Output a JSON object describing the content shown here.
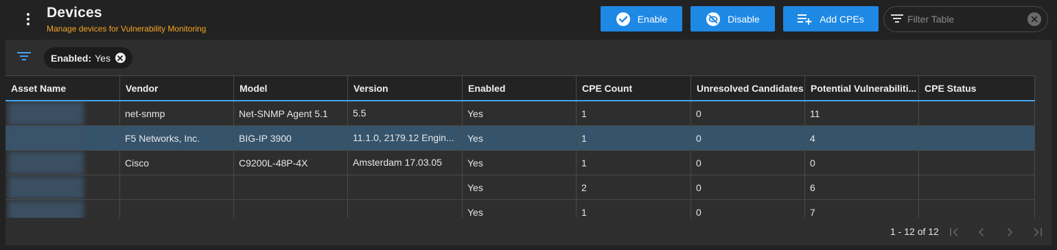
{
  "header": {
    "title": "Devices",
    "subtitle": "Manage devices for Vulnerability Monitoring",
    "menu_icon": "more-vert-icon"
  },
  "toolbar": {
    "enable_label": "Enable",
    "disable_label": "Disable",
    "add_cpes_label": "Add CPEs",
    "filter_placeholder": "Filter Table",
    "filter_value": ""
  },
  "chip": {
    "key": "Enabled:",
    "value": "Yes"
  },
  "table": {
    "columns": [
      "Asset Name",
      "Vendor",
      "Model",
      "Version",
      "Enabled",
      "CPE Count",
      "Unresolved Candidates",
      "Potential Vulnerabiliti...",
      "CPE Status"
    ],
    "rows": [
      {
        "asset": "",
        "vendor": "net-snmp",
        "model": "Net-SNMP Agent 5.1",
        "version": "5.5",
        "enabled": "Yes",
        "cpe_count": "1",
        "unresolved": "0",
        "potential": "11",
        "status": ""
      },
      {
        "asset": "",
        "vendor": "F5 Networks, Inc.",
        "model": "BIG-IP 3900",
        "version": "11.1.0, 2179.12 Engin...",
        "enabled": "Yes",
        "cpe_count": "1",
        "unresolved": "0",
        "potential": "4",
        "status": "",
        "selected": true
      },
      {
        "asset": "",
        "vendor": "Cisco",
        "model": "C9200L-48P-4X",
        "version": "Amsterdam 17.03.05",
        "enabled": "Yes",
        "cpe_count": "1",
        "unresolved": "0",
        "potential": "0",
        "status": ""
      },
      {
        "asset": "",
        "vendor": "",
        "model": "",
        "version": "",
        "enabled": "Yes",
        "cpe_count": "2",
        "unresolved": "0",
        "potential": "6",
        "status": ""
      },
      {
        "asset": "",
        "vendor": "",
        "model": "",
        "version": "",
        "enabled": "Yes",
        "cpe_count": "1",
        "unresolved": "0",
        "potential": "7",
        "status": ""
      }
    ]
  },
  "paginator": {
    "range_label": "1 - 12 of 12"
  },
  "colors": {
    "accent": "#1e88e5",
    "subtitle": "#f5a623",
    "selected_row": "#35536b",
    "header_underline": "#42a5f5"
  }
}
